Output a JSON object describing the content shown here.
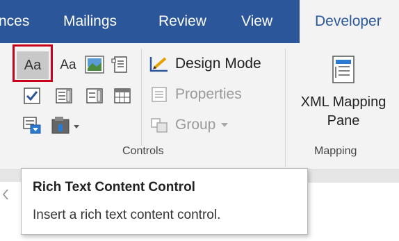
{
  "tabs": [
    "nces",
    "Mailings",
    "Review",
    "View",
    "Developer"
  ],
  "active_tab": "Developer",
  "controls_group": {
    "label": "Controls",
    "design_mode": "Design Mode",
    "properties": "Properties",
    "group": "Group",
    "rich_text_glyph": "Aa",
    "plain_text_glyph": "Aa"
  },
  "mapping_group": {
    "label": "Mapping",
    "xml_line1": "XML Mapping",
    "xml_line2": "Pane"
  },
  "tooltip": {
    "title": "Rich Text Content Control",
    "description": "Insert a rich text content control."
  },
  "colors": {
    "tab_bar": "#2b579a",
    "ribbon": "#f3f3f3",
    "highlight_border": "#c8001c"
  }
}
